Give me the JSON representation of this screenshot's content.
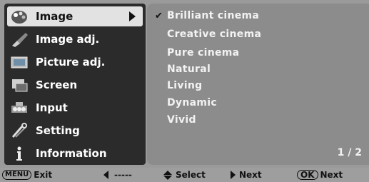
{
  "menu": {
    "items": [
      {
        "label": "Image",
        "icon": "palette-icon",
        "selected": true
      },
      {
        "label": "Image adj.",
        "icon": "brush-icon"
      },
      {
        "label": "Picture adj.",
        "icon": "picture-icon"
      },
      {
        "label": "Screen",
        "icon": "screen-icon"
      },
      {
        "label": "Input",
        "icon": "input-icon"
      },
      {
        "label": "Setting",
        "icon": "tools-icon"
      },
      {
        "label": "Information",
        "icon": "info-icon"
      }
    ]
  },
  "submenu": {
    "items": [
      {
        "label": "Brilliant cinema",
        "checked": true
      },
      {
        "label": "Creative cinema"
      },
      {
        "label": "Pure cinema"
      },
      {
        "label": "Natural"
      },
      {
        "label": "Living"
      },
      {
        "label": "Dynamic"
      },
      {
        "label": "Vivid"
      }
    ],
    "check_mark": "✔",
    "page": "1 / 2"
  },
  "bottom_bar": {
    "menu_key": "MENU",
    "exit": "Exit",
    "back_value": "-----",
    "select": "Select",
    "next": "Next",
    "ok_key": "OK",
    "ok_next": "Next"
  },
  "colors": {
    "background": "#9a9a9a",
    "menu_bg": "#2b2b2b",
    "selected_bg": "#e2e2e2",
    "submenu_bg": "#8c8c8c"
  }
}
